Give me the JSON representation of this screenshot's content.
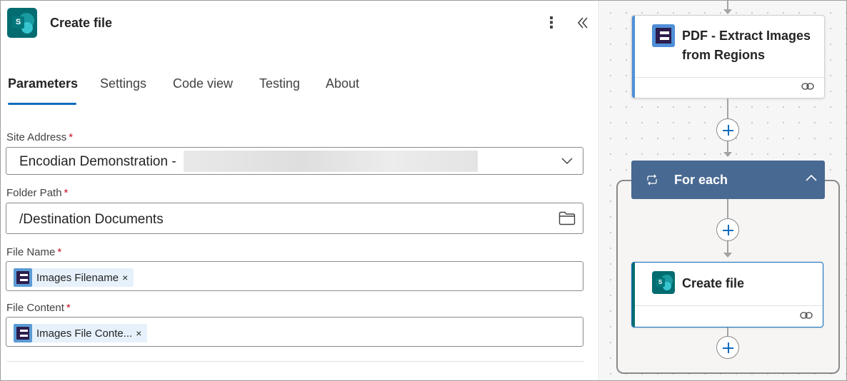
{
  "panel": {
    "title": "Create file",
    "more_icon": "more-vertical-icon",
    "collapse_icon": "double-chevron-left-icon",
    "tabs": [
      {
        "label": "Parameters",
        "active": true
      },
      {
        "label": "Settings",
        "active": false
      },
      {
        "label": "Code view",
        "active": false
      },
      {
        "label": "Testing",
        "active": false
      },
      {
        "label": "About",
        "active": false
      }
    ],
    "fields": {
      "site_address": {
        "label": "Site Address",
        "required": "*",
        "value": "Encodian Demonstration -"
      },
      "folder_path": {
        "label": "Folder Path",
        "required": "*",
        "value": "/Destination Documents"
      },
      "file_name": {
        "label": "File Name",
        "required": "*",
        "token": "Images Filename",
        "token_remove": "×"
      },
      "file_content": {
        "label": "File Content",
        "required": "*",
        "token": "Images File Conte...",
        "token_remove": "×"
      }
    }
  },
  "canvas": {
    "nodes": {
      "pdf_extract": {
        "title_line1": "PDF - Extract Images",
        "title_line2": "from Regions"
      },
      "for_each": {
        "title": "For each"
      },
      "create_file": {
        "title": "Create file"
      }
    }
  },
  "colors": {
    "accent": "#0f6cbd",
    "required": "#c50f1f",
    "foreach_header": "#486991",
    "encodian_stripe": "#4f8fd8",
    "sharepoint_stripe": "#036c70"
  }
}
